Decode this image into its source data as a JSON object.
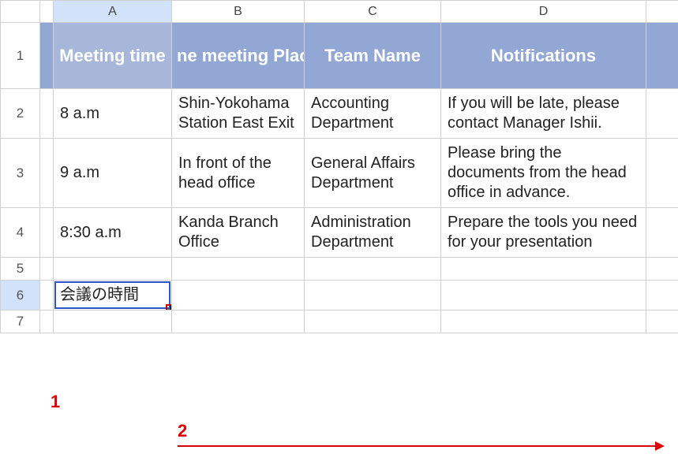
{
  "columnLabels": {
    "a": "A",
    "b": "B",
    "c": "C",
    "d": "D"
  },
  "rowLabels": {
    "r1": "1",
    "r2": "2",
    "r3": "3",
    "r4": "4",
    "r5": "5",
    "r6": "6",
    "r7": "7"
  },
  "headerRow": {
    "a": "Meeting time",
    "b": "ne meeting Plac",
    "c": "Team Name",
    "d": "Notifications"
  },
  "rows": [
    {
      "a": "8 a.m",
      "b": "Shin-Yokohama Station East Exit",
      "c": "Accounting Department",
      "d": "If you will be late, please contact Manager Ishii."
    },
    {
      "a": "9 a.m",
      "b": "In front of the head office",
      "c": "General Affairs Department",
      "d": "Please bring the documents from the head office in advance."
    },
    {
      "a": "8:30 a.m",
      "b": "Kanda Branch Office",
      "c": "Administration Department",
      "d": "Prepare the tools you need for your presentation"
    }
  ],
  "activeCell": {
    "value": "会議の時間"
  },
  "annotations": {
    "label1": "1",
    "label2": "2"
  }
}
